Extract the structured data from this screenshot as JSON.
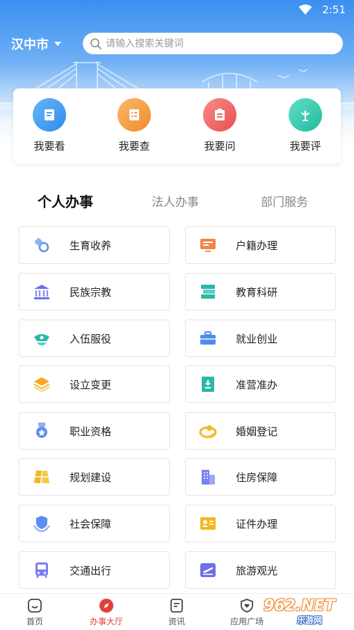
{
  "status_bar": {
    "time": "2:51",
    "wifi_icon": "wifi-icon"
  },
  "header": {
    "city": "汉中市",
    "search_placeholder": "请输入搜索关键词"
  },
  "quick_actions": [
    {
      "label": "我要看",
      "icon": "book-icon",
      "color": "#3f9cf1"
    },
    {
      "label": "我要查",
      "icon": "list-check-icon",
      "color": "#f39b3a"
    },
    {
      "label": "我要问",
      "icon": "clipboard-icon",
      "color": "#ee5a5a"
    },
    {
      "label": "我要评",
      "icon": "flower-icon",
      "color": "#33c9b0"
    }
  ],
  "tabs": [
    {
      "label": "个人办事",
      "active": true
    },
    {
      "label": "法人办事",
      "active": false
    },
    {
      "label": "部门服务",
      "active": false
    }
  ],
  "services": [
    {
      "label": "生育收养",
      "icon": "pacifier-icon"
    },
    {
      "label": "户籍办理",
      "icon": "id-card-icon"
    },
    {
      "label": "民族宗教",
      "icon": "temple-icon"
    },
    {
      "label": "教育科研",
      "icon": "books-icon"
    },
    {
      "label": "入伍服役",
      "icon": "military-cap-icon"
    },
    {
      "label": "就业创业",
      "icon": "briefcase-icon"
    },
    {
      "label": "设立变更",
      "icon": "layers-icon"
    },
    {
      "label": "准营准办",
      "icon": "document-download-icon"
    },
    {
      "label": "职业资格",
      "icon": "medal-icon"
    },
    {
      "label": "婚姻登记",
      "icon": "rings-icon"
    },
    {
      "label": "规划建设",
      "icon": "map-blocks-icon"
    },
    {
      "label": "住房保障",
      "icon": "building-icon"
    },
    {
      "label": "社会保障",
      "icon": "shield-hands-icon"
    },
    {
      "label": "证件办理",
      "icon": "contact-card-icon"
    },
    {
      "label": "交通出行",
      "icon": "bus-icon"
    },
    {
      "label": "旅游观光",
      "icon": "plane-icon"
    }
  ],
  "bottom_nav": [
    {
      "label": "首页",
      "icon": "home-face-icon",
      "active": false
    },
    {
      "label": "办事大厅",
      "icon": "compass-icon",
      "active": true
    },
    {
      "label": "资讯",
      "icon": "news-icon",
      "active": false
    },
    {
      "label": "应用广场",
      "icon": "heart-shield-icon",
      "active": false
    }
  ],
  "watermark": {
    "number": "962.NET",
    "text": "乐游网"
  },
  "colors": {
    "accent": "#e0403a",
    "header_blue": "#3b8ff0"
  }
}
